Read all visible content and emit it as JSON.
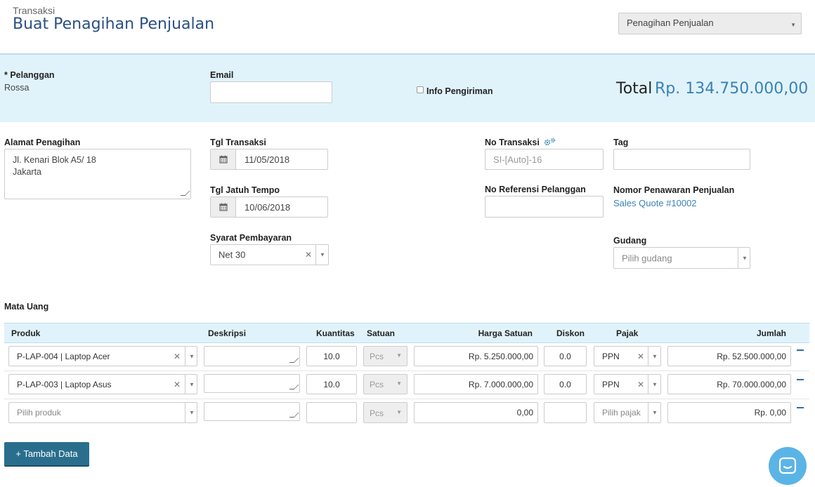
{
  "header": {
    "breadcrumb": "Transaksi",
    "title": "Buat Penagihan Penjualan",
    "type_select": "Penagihan Penjualan"
  },
  "band": {
    "customer_label": "* Pelanggan",
    "customer_value": "Rossa",
    "email_label": "Email",
    "email_value": "",
    "shipping_label": "Info Pengiriman",
    "total_label": "Total",
    "total_value": "Rp. 134.750.000,00"
  },
  "form": {
    "billing_address_label": "Alamat Penagihan",
    "billing_address_line1": "Jl. Kenari Blok A5/ 18",
    "billing_address_line2": "Jakarta",
    "trx_date_label": "Tgl Transaksi",
    "trx_date": "11/05/2018",
    "due_date_label": "Tgl Jatuh Tempo",
    "due_date": "10/06/2018",
    "terms_label": "Syarat Pembayaran",
    "terms_value": "Net 30",
    "trx_no_label": "No Transaksi",
    "trx_no_placeholder": "SI-[Auto]-16",
    "ref_label": "No Referensi Pelanggan",
    "tag_label": "Tag",
    "quote_label": "Nomor Penawaran Penjualan",
    "quote_link": "Sales Quote #10002",
    "warehouse_label": "Gudang",
    "warehouse_placeholder": "Pilih gudang",
    "currency_label": "Mata Uang"
  },
  "table": {
    "headers": {
      "produk": "Produk",
      "deskripsi": "Deskripsi",
      "kuantitas": "Kuantitas",
      "satuan": "Satuan",
      "harga": "Harga Satuan",
      "diskon": "Diskon",
      "pajak": "Pajak",
      "jumlah": "Jumlah"
    },
    "rows": [
      {
        "produk": "P-LAP-004 | Laptop Acer",
        "kuantitas": "10.0",
        "satuan": "Pcs",
        "harga": "Rp. 5.250.000,00",
        "diskon": "0.0",
        "pajak": "PPN",
        "jumlah": "Rp. 52.500.000,00"
      },
      {
        "produk": "P-LAP-003 | Laptop Asus",
        "kuantitas": "10.0",
        "satuan": "Pcs",
        "harga": "Rp. 7.000.000,00",
        "diskon": "0.0",
        "pajak": "PPN",
        "jumlah": "Rp. 70.000.000,00"
      },
      {
        "produk": "Pilih produk",
        "kuantitas": "",
        "satuan": "Pcs",
        "harga": "0,00",
        "diskon": "",
        "pajak": "Pilih pajak",
        "jumlah": "Rp. 0,00"
      }
    ]
  },
  "actions": {
    "add_row": "+ Tambah Data"
  },
  "colors": {
    "accent": "#3a81b4",
    "band": "#e0f3fb",
    "button": "#2a6e8e"
  }
}
